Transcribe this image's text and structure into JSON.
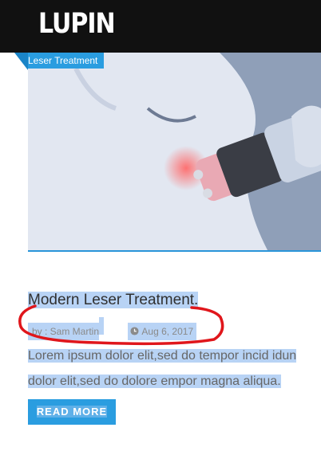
{
  "header": {
    "logo": "LUPIN"
  },
  "post": {
    "category": "Leser Treatment",
    "title": "Modern Leser Treatment.",
    "author": "by : Sam Martin",
    "date": "Aug 6, 2017",
    "excerpt_line1": "Lorem ipsum dolor elit,sed do tempor incid idun",
    "excerpt_line2": "dolor elit,sed do dolore empor magna aliqua.",
    "read_more": "READ MORE",
    "image_alt": "laser treatment photo"
  },
  "colors": {
    "accent": "#2a9de0",
    "topbar": "#111111",
    "selection": "#b8d3f5",
    "annotation": "#e0161b"
  },
  "icons": {
    "date": "clock-icon"
  }
}
